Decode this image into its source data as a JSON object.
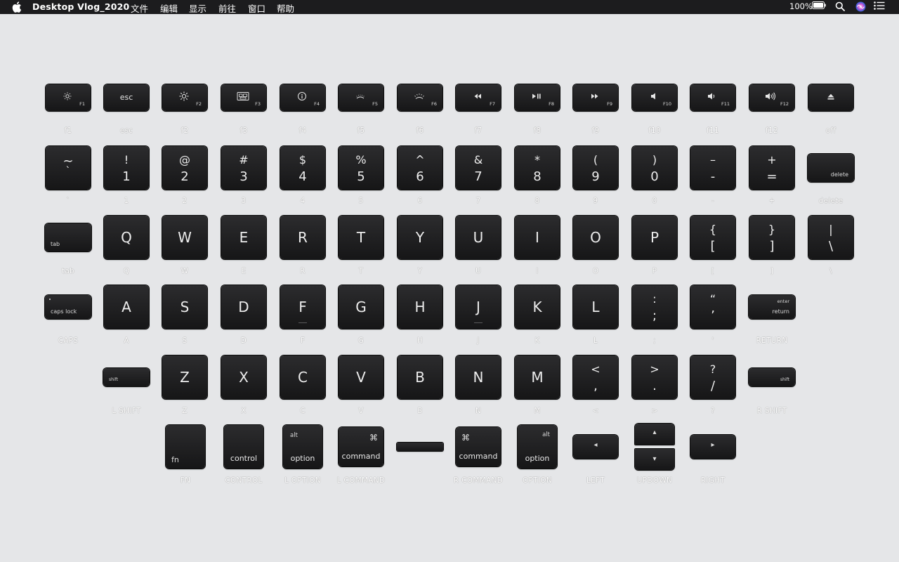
{
  "menubar": {
    "app_title": "Desktop Vlog_2020",
    "menus": [
      "文件",
      "编辑",
      "显示",
      "前往",
      "窗口",
      "帮助"
    ],
    "battery_text": "100%",
    "icons": [
      "apple-icon",
      "battery-icon",
      "search-icon",
      "siri-icon",
      "notification-center-icon"
    ]
  },
  "rows": {
    "function": {
      "labels": [
        "f1",
        "esc",
        "f2",
        "f3",
        "f4",
        "f5",
        "f6",
        "f7",
        "f8",
        "f9",
        "f10",
        "f11",
        "f12",
        "off"
      ],
      "key_fn_labels": [
        "F1",
        "",
        "F2",
        "F3",
        "F4",
        "F5",
        "F6",
        "F7",
        "F8",
        "F9",
        "F10",
        "F11",
        "F12",
        ""
      ],
      "icons": [
        "brightness-down-icon",
        "",
        "brightness-up-icon",
        "mission-control-icon",
        "launchpad-icon",
        "keyboard-light-down-icon",
        "keyboard-light-up-icon",
        "rewind-icon",
        "play-pause-icon",
        "fast-forward-icon",
        "mute-icon",
        "volume-down-icon",
        "volume-up-icon",
        "eject-icon"
      ],
      "esc_cap": "esc"
    },
    "number": {
      "labels": [
        "`",
        "1",
        "2",
        "3",
        "4",
        "5",
        "6",
        "7",
        "8",
        "9",
        "0",
        "-",
        "+",
        "delete"
      ],
      "top": [
        "~",
        "!",
        "@",
        "#",
        "$",
        "%",
        "^",
        "&",
        "*",
        "(",
        ")",
        "–",
        "+",
        ""
      ],
      "bottom": [
        "`",
        "1",
        "2",
        "3",
        "4",
        "5",
        "6",
        "7",
        "8",
        "9",
        "0",
        "-",
        "=",
        ""
      ],
      "delete_cap": "delete"
    },
    "qwerty": {
      "labels": [
        "tab",
        "Q",
        "W",
        "E",
        "R",
        "T",
        "Y",
        "U",
        "I",
        "O",
        "P",
        "[",
        "]",
        "\\"
      ],
      "caps": [
        "",
        "Q",
        "W",
        "E",
        "R",
        "T",
        "Y",
        "U",
        "I",
        "O",
        "P",
        "",
        "",
        ""
      ],
      "top": [
        "",
        "",
        "",
        "",
        "",
        "",
        "",
        "",
        "",
        "",
        "",
        "{",
        "}",
        "|"
      ],
      "bottom": [
        "",
        "",
        "",
        "",
        "",
        "",
        "",
        "",
        "",
        "",
        "",
        "[",
        "]",
        "\\"
      ],
      "tab_cap": "tab"
    },
    "home": {
      "labels": [
        "CAPS",
        "A",
        "S",
        "D",
        "F",
        "G",
        "H",
        "J",
        "K",
        "L",
        ";",
        "'",
        "RETURN"
      ],
      "caps": [
        "",
        "A",
        "S",
        "D",
        "F",
        "G",
        "H",
        "J",
        "K",
        "L",
        "",
        "",
        ""
      ],
      "top": [
        "",
        "",
        "",
        "",
        "",
        "",
        "",
        "",
        "",
        "",
        ":",
        "“",
        ""
      ],
      "bottom": [
        "",
        "",
        "",
        "",
        "",
        "",
        "",
        "",
        "",
        "",
        ";",
        "’",
        ""
      ],
      "caps_cap": "caps lock",
      "return_top": "enter",
      "return_bottom": "return"
    },
    "shift": {
      "labels": [
        "L SHIFT",
        "Z",
        "X",
        "C",
        "V",
        "B",
        "N",
        "M",
        "<",
        ">",
        "?",
        "R SHIFT"
      ],
      "caps": [
        "",
        "Z",
        "X",
        "C",
        "V",
        "B",
        "N",
        "M",
        "",
        "",
        "",
        ""
      ],
      "top": [
        "",
        "",
        "",
        "",
        "",
        "",
        "",
        "",
        "<",
        ">",
        "?",
        ""
      ],
      "bottom": [
        "",
        "",
        "",
        "",
        "",
        "",
        "",
        "",
        ",",
        ".",
        "/",
        ""
      ],
      "shift_cap": "shift"
    },
    "bottom": {
      "labels": [
        "FN",
        "CONTROL",
        "L OPTION",
        "L COMMAND",
        "",
        "R COMMAND",
        "OPTION",
        "LEFT",
        "UPDOWN",
        "RIGHT"
      ],
      "fn_cap": "fn",
      "control_cap": "control",
      "option_top": "alt",
      "option_bottom": "option",
      "command_symbol": "⌘",
      "command_cap": "command",
      "arrow_left": "◂",
      "arrow_right": "▸",
      "arrow_up": "▴",
      "arrow_down": "▾"
    }
  },
  "colors": {
    "background": "#e5e6e8",
    "menubar": "#1c1c1e",
    "key": "#1e1e1f",
    "key_text": "#ececec",
    "label_text": "#ffffff"
  }
}
